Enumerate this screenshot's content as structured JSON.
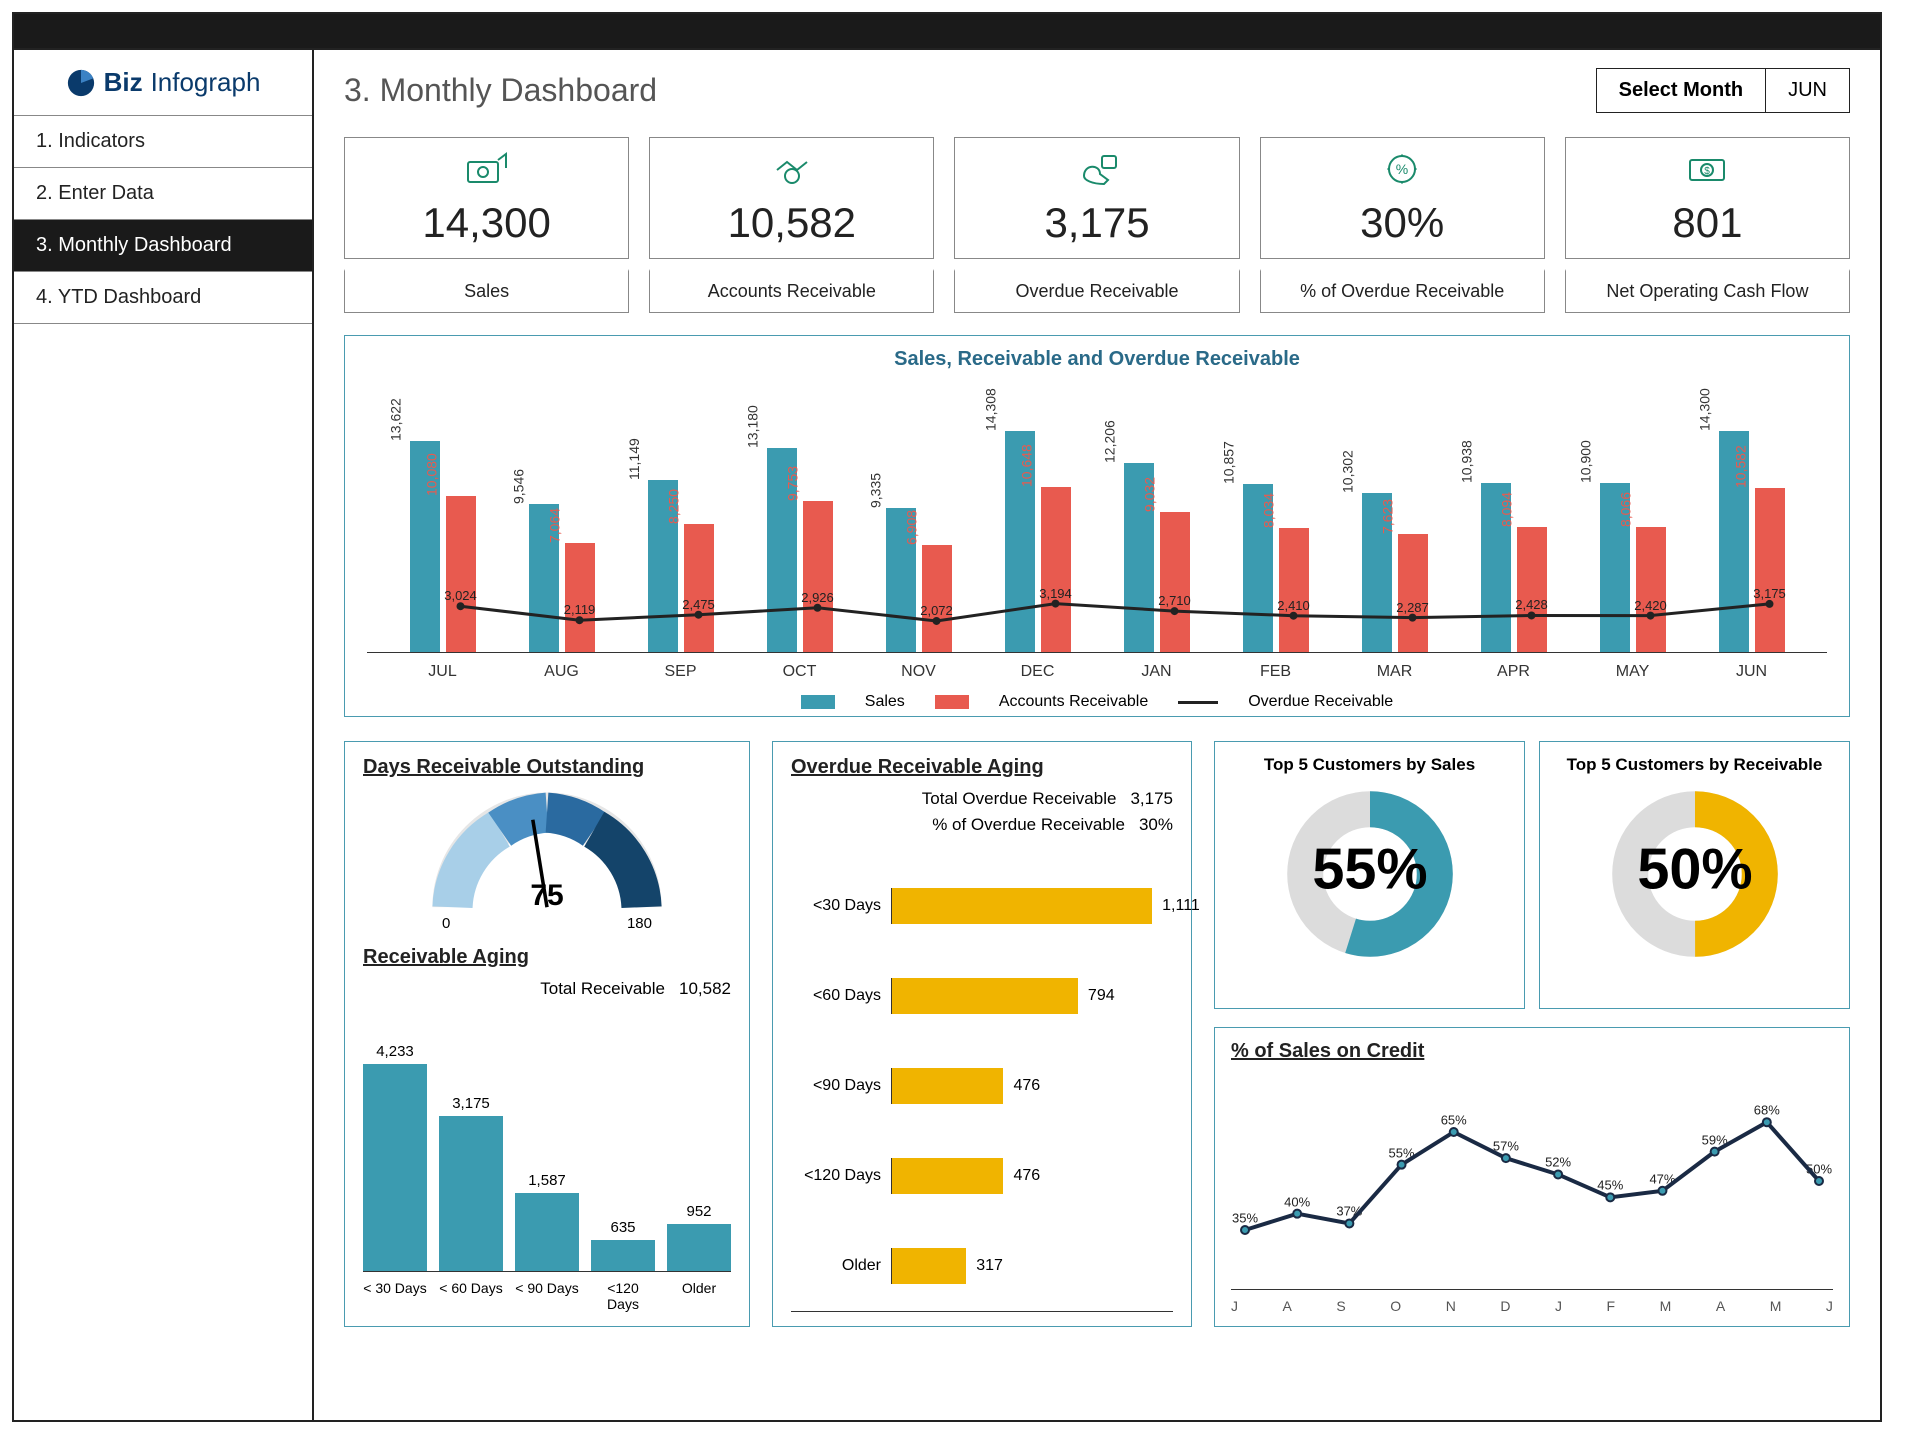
{
  "brand": {
    "a": "Biz",
    "b": "Infograph"
  },
  "nav": {
    "items": [
      {
        "label": "1. Indicators"
      },
      {
        "label": "2. Enter Data"
      },
      {
        "label": "3. Monthly Dashboard"
      },
      {
        "label": "4. YTD Dashboard"
      }
    ],
    "active_index": 2
  },
  "header": {
    "title": "3. Monthly Dashboard",
    "month_selector_label": "Select Month",
    "month_selector_value": "JUN"
  },
  "kpis": [
    {
      "value": "14,300",
      "label": "Sales"
    },
    {
      "value": "10,582",
      "label": "Accounts Receivable"
    },
    {
      "value": "3,175",
      "label": "Overdue Receivable"
    },
    {
      "value": "30%",
      "label": "% of Overdue Receivable"
    },
    {
      "value": "801",
      "label": "Net Operating Cash Flow"
    }
  ],
  "chart_data": [
    {
      "id": "main_trend",
      "type": "bar+line",
      "title": "Sales, Receivable and Overdue Receivable",
      "categories": [
        "JUL",
        "AUG",
        "SEP",
        "OCT",
        "NOV",
        "DEC",
        "JAN",
        "FEB",
        "MAR",
        "APR",
        "MAY",
        "JUN"
      ],
      "series": [
        {
          "name": "Sales",
          "type": "bar",
          "color": "#3b9bb0",
          "values": [
            13622,
            9546,
            11149,
            13180,
            9335,
            14308,
            12206,
            10857,
            10302,
            10938,
            10900,
            14300
          ],
          "labels": [
            "13,622",
            "9,546",
            "11,149",
            "13,180",
            "9,335",
            "14,308",
            "12,206",
            "10,857",
            "10,302",
            "10,938",
            "10,900",
            "14,300"
          ]
        },
        {
          "name": "Accounts Receivable",
          "type": "bar",
          "color": "#e85a4f",
          "values": [
            10080,
            7064,
            8250,
            9753,
            6908,
            10648,
            9032,
            8034,
            7623,
            8094,
            8066,
            10582
          ],
          "labels": [
            "10,080",
            "7,064",
            "8,250",
            "9,753",
            "6,908",
            "10,648",
            "9,032",
            "8,034",
            "7,623",
            "8,094",
            "8,066",
            "10,582"
          ]
        },
        {
          "name": "Overdue Receivable",
          "type": "line",
          "color": "#222",
          "values": [
            3024,
            2119,
            2475,
            2926,
            2072,
            3194,
            2710,
            2410,
            2287,
            2428,
            2420,
            3175
          ],
          "labels": [
            "3,024",
            "2,119",
            "2,475",
            "2,926",
            "2,072",
            "3,194",
            "2,710",
            "2,410",
            "2,287",
            "2,428",
            "2,420",
            "3,175"
          ]
        }
      ],
      "legend": [
        "Sales",
        "Accounts Receivable",
        "Overdue Receivable"
      ],
      "ymax": 15000
    },
    {
      "id": "dro_gauge",
      "type": "gauge",
      "title": "Days Receivable Outstanding",
      "value": 75,
      "min": 0,
      "max": 180,
      "min_label": "0",
      "max_label": "180",
      "value_label": "75"
    },
    {
      "id": "receivable_aging",
      "type": "bar",
      "title": "Receivable Aging",
      "total_label": "Total Receivable",
      "total_value": "10,582",
      "categories": [
        "< 30 Days",
        "< 60 Days",
        "< 90 Days",
        "<120 Days",
        "Older"
      ],
      "values": [
        4233,
        3175,
        1587,
        635,
        952
      ],
      "labels": [
        "4,233",
        "3,175",
        "1,587",
        "635",
        "952"
      ],
      "ymax": 4500,
      "color": "#3b9bb0"
    },
    {
      "id": "overdue_aging",
      "type": "bar_horizontal",
      "title": "Overdue Receivable Aging",
      "kv": [
        {
          "k": "Total  Overdue Receivable",
          "v": "3,175"
        },
        {
          "k": "% of Overdue Receivable",
          "v": "30%"
        }
      ],
      "categories": [
        "<30 Days",
        "<60 Days",
        "<90 Days",
        "<120 Days",
        "Older"
      ],
      "values": [
        1111,
        794,
        476,
        476,
        317
      ],
      "labels": [
        "1,111",
        "794",
        "476",
        "476",
        "317"
      ],
      "xmax": 1200,
      "color": "#f0b400"
    },
    {
      "id": "top5_sales",
      "type": "donut",
      "title": "Top 5 Customers by Sales",
      "value": 55,
      "label": "55%",
      "color": "#3b9bb0"
    },
    {
      "id": "top5_receivable",
      "type": "donut",
      "title": "Top 5 Customers by Receivable",
      "value": 50,
      "label": "50%",
      "color": "#f0b400"
    },
    {
      "id": "credit_pct",
      "type": "line",
      "title": "% of Sales on Credit",
      "categories": [
        "J",
        "A",
        "S",
        "O",
        "N",
        "D",
        "J",
        "F",
        "M",
        "A",
        "M",
        "J"
      ],
      "values": [
        35,
        40,
        37,
        55,
        65,
        57,
        52,
        45,
        47,
        59,
        68,
        50
      ],
      "labels": [
        "35%",
        "40%",
        "37%",
        "55%",
        "65%",
        "57%",
        "52%",
        "45%",
        "47%",
        "59%",
        "68%",
        "50%"
      ],
      "ymax": 80,
      "ymin": 20,
      "color": "#1a2a44"
    }
  ]
}
